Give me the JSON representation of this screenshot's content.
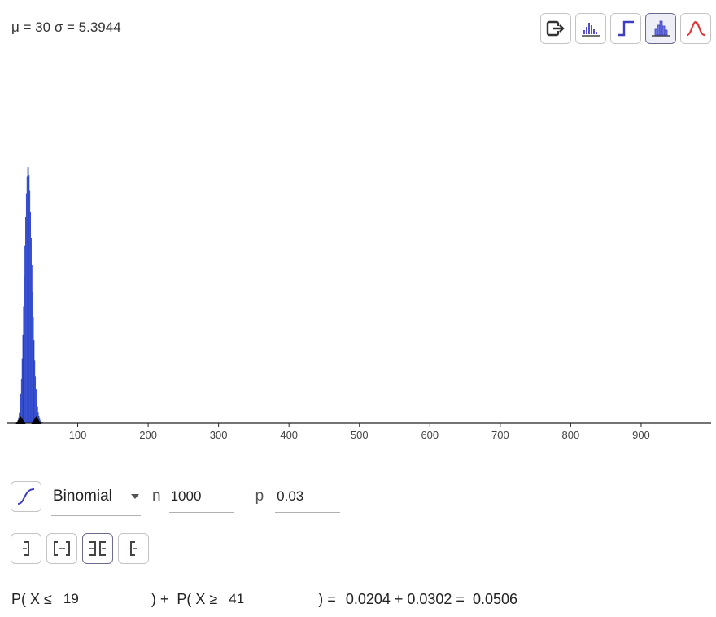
{
  "stats": {
    "mean_label": "μ = 30",
    "sd_label": "σ = 5.3944"
  },
  "toolbar": {
    "buttons": [
      {
        "name": "export-icon",
        "active": false
      },
      {
        "name": "bar-graph-icon",
        "active": false
      },
      {
        "name": "step-graph-icon",
        "active": false
      },
      {
        "name": "histogram-icon",
        "active": true
      },
      {
        "name": "normal-overlay-icon",
        "active": false
      }
    ]
  },
  "chart_data": {
    "type": "area",
    "x_ticks": [
      "100",
      "200",
      "300",
      "400",
      "500",
      "600",
      "700",
      "800",
      "900"
    ],
    "xlim": [
      0,
      1000
    ],
    "distribution": "binomial",
    "n": 1000,
    "p": 0.03,
    "mean": 30,
    "sd": 5.3944,
    "marked_points": [
      19,
      41
    ],
    "fill_color": "#1f39c8",
    "marker_color": "#000000",
    "grid": false
  },
  "controls": {
    "cumulative_toggle_icon": "cdf-curve-icon",
    "distribution": "Binomial",
    "n_label": "n",
    "n_value": "1000",
    "p_label": "p",
    "p_value": "0.03"
  },
  "interval_buttons": [
    {
      "name": "left-sided-icon",
      "active": false
    },
    {
      "name": "interval-icon",
      "active": false
    },
    {
      "name": "two-tailed-icon",
      "active": true
    },
    {
      "name": "right-sided-icon",
      "active": false
    }
  ],
  "probability": {
    "prefix_left": "P( X ≤",
    "left_value": "19",
    "mid": ") +  P( X ≥",
    "right_value": "41",
    "equals": ") =",
    "result": "0.0204 + 0.0302 =  0.0506"
  }
}
